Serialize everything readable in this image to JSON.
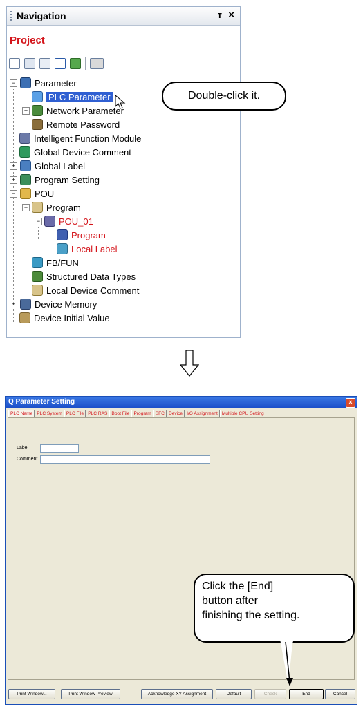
{
  "navigation": {
    "title": "Navigation",
    "pin_glyph": "ᴛ",
    "close_glyph": "×",
    "project_label": "Project",
    "toolbar_icons": [
      "new-data-icon",
      "copy-data-icon",
      "paste-data-icon",
      "property-icon",
      "refresh-icon",
      "sort-icon"
    ],
    "tree": [
      {
        "label": "Parameter",
        "icon": "parameter-icon",
        "expander": "−"
      },
      {
        "label": "PLC Parameter",
        "icon": "plc-parameter-icon",
        "selected": true
      },
      {
        "label": "Network Parameter",
        "icon": "network-parameter-icon",
        "expander": "+"
      },
      {
        "label": "Remote Password",
        "icon": "remote-password-icon"
      },
      {
        "label": "Intelligent Function Module",
        "icon": "intelligent-module-icon"
      },
      {
        "label": "Global Device Comment",
        "icon": "global-device-comment-icon"
      },
      {
        "label": "Global Label",
        "icon": "global-label-icon",
        "expander": "+"
      },
      {
        "label": "Program Setting",
        "icon": "program-setting-icon",
        "expander": "+"
      },
      {
        "label": "POU",
        "icon": "pou-icon",
        "expander": "−"
      },
      {
        "label": "Program",
        "icon": "program-folder-icon",
        "expander": "−"
      },
      {
        "label": "POU_01",
        "icon": "pou01-icon",
        "expander": "−",
        "color": "#d4151b"
      },
      {
        "label": "Program",
        "icon": "program-body-icon",
        "color": "#d4151b"
      },
      {
        "label": "Local Label",
        "icon": "local-label-icon",
        "color": "#d4151b"
      },
      {
        "label": "FB/FUN",
        "icon": "fb-fun-icon"
      },
      {
        "label": "Structured Data Types",
        "icon": "structured-data-icon"
      },
      {
        "label": "Local Device Comment",
        "icon": "local-device-comment-icon"
      },
      {
        "label": "Device Memory",
        "icon": "device-memory-icon",
        "expander": "+"
      },
      {
        "label": "Device Initial Value",
        "icon": "device-initial-value-icon"
      }
    ]
  },
  "callouts": {
    "double_click": "Double-click it.",
    "end_button_line1": "Click the [End]",
    "end_button_line2": "button after",
    "end_button_line3": "finishing the setting."
  },
  "dialog": {
    "title": "Q Parameter Setting",
    "close_glyph": "×",
    "tabs": [
      "PLC Name",
      "PLC System",
      "PLC File",
      "PLC RAS",
      "Boot File",
      "Program",
      "SFC",
      "Device",
      "I/O Assignment",
      "Multiple CPU Setting"
    ],
    "label_field": {
      "label": "Label",
      "value": ""
    },
    "comment_field": {
      "label": "Comment",
      "value": ""
    },
    "buttons": {
      "print_window": "Print Window...",
      "print_preview": "Print Window Preview",
      "acknowledge": "Acknowledge XY Assignment",
      "default": "Default",
      "check": "Check",
      "end": "End",
      "cancel": "Cancel"
    }
  },
  "colors": {
    "accent_red": "#d4151b",
    "selection": "#2f5fd2",
    "titlebar": "#1b4fc9"
  }
}
